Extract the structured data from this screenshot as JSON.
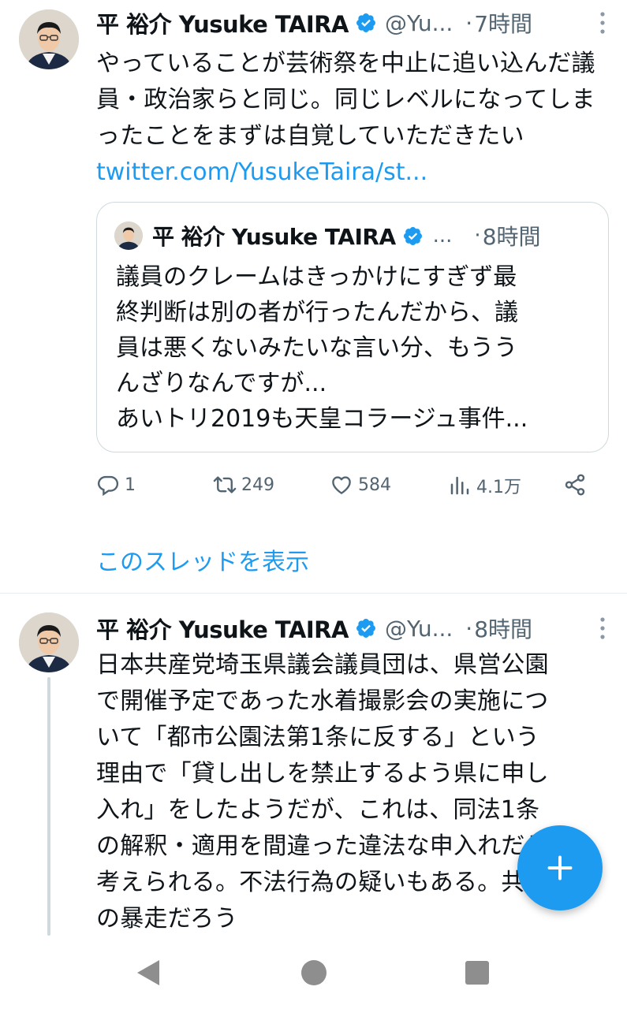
{
  "colors": {
    "accent": "#1d9bf0",
    "text": "#0f1419",
    "secondary": "#536471",
    "border": "#cfd9de"
  },
  "tweet1": {
    "author_name": "平 裕介 Yusuke TAIRA",
    "handle": "@Yu...",
    "separator": "·",
    "time": "7時間",
    "text": "やっていることが芸術祭を中止に追い込んだ議員・政治家らと同じ。同じレベルになってしまったことをまずは自覚していただきたい",
    "link": "twitter.com/YusukeTaira/st...",
    "quote": {
      "author_name": "平 裕介 Yusuke TAIRA",
      "handle": "...",
      "separator": "·",
      "time": "8時間",
      "text_lines": [
        "議員のクレームはきっかけにすぎず最",
        "終判断は別の者が行ったんだから、議",
        "員は悪くないみたいな言い分、もうう",
        "んざりなんですが...",
        "あいトリ2019も天皇コラージュ事件..."
      ]
    },
    "actions": {
      "replies": "1",
      "retweets": "249",
      "likes": "584",
      "views": "4.1万"
    },
    "show_thread": "このスレッドを表示"
  },
  "tweet2": {
    "author_name": "平 裕介 Yusuke TAIRA",
    "handle": "@Yu...",
    "separator": "·",
    "time": "8時間",
    "text_lines": [
      "日本共産党埼玉県議会議員団は、県営公園",
      "で開催予定であった水着撮影会の実施につ",
      "いて「都市公園法第1条に反する」という",
      "理由で「貸し出しを禁止するよう県に申し",
      "入れ」をしたようだが、これは、同法1条",
      "の解釈・適用を間違った違法な申入れだと",
      "考えられる。不法行為の疑いもある。共産党",
      "の暴走だろう"
    ]
  },
  "icons": {
    "verified": "verified-badge-icon",
    "more": "more-vertical-icon",
    "reply": "reply-icon",
    "retweet": "retweet-icon",
    "like": "heart-icon",
    "views": "views-chart-icon",
    "share": "share-icon",
    "compose": "plus-icon"
  }
}
